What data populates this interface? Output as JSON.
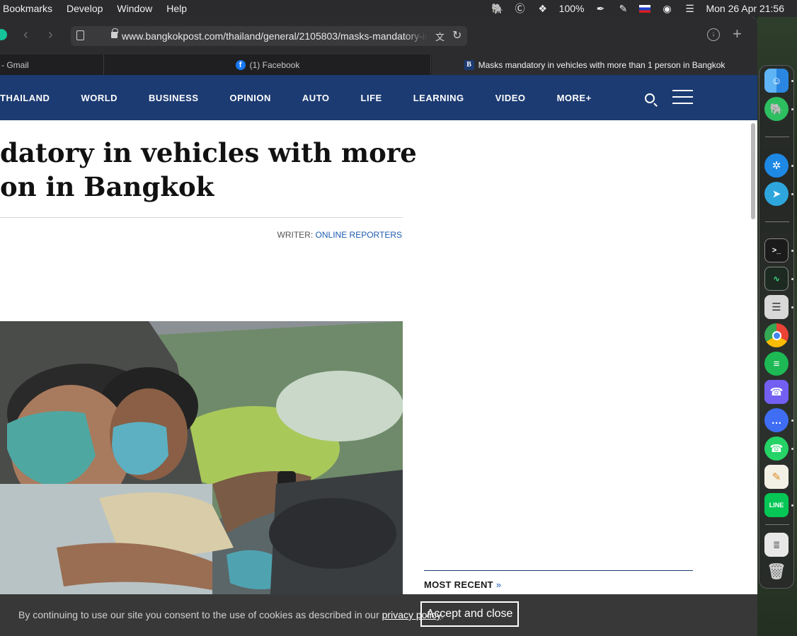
{
  "menubar": {
    "items": [
      "Bookmarks",
      "Develop",
      "Window",
      "Help"
    ],
    "battery": "100%",
    "clock": "Mon 26 Apr  21:56"
  },
  "browser": {
    "url": "www.bangkokpost.com/thailand/general/2105803/masks-mandatory-in-",
    "tabs": [
      {
        "label": "- Gmail"
      },
      {
        "label": "(1) Facebook"
      },
      {
        "label": "Masks mandatory in vehicles with more than 1 person in Bangkok"
      }
    ]
  },
  "site_nav": {
    "links": [
      "THAILAND",
      "WORLD",
      "BUSINESS",
      "OPINION",
      "AUTO",
      "LIFE",
      "LEARNING",
      "VIDEO",
      "MORE+"
    ]
  },
  "article": {
    "headline_line1": "datory in vehicles with more",
    "headline_line2": "on in Bangkok",
    "writer_label": "WRITER: ",
    "writer_name": "ONLINE REPORTERS"
  },
  "sidebar": {
    "most_recent": "MOST RECENT",
    "chevron": "»"
  },
  "cookie_banner": {
    "text_before": "By continuing to use our site you consent to the use of cookies as described in our ",
    "link": "privacy policy",
    "text_after": ".",
    "button": "Accept and close"
  },
  "colors": {
    "nav_bg": "#1c3b72",
    "link": "#1d5bb0",
    "banner_bg": "#383838"
  }
}
